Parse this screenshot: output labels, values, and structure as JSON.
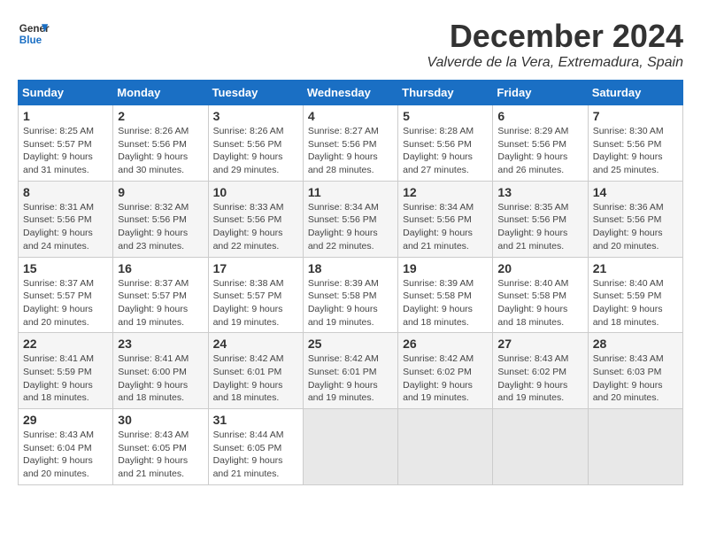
{
  "header": {
    "logo_line1": "General",
    "logo_line2": "Blue",
    "month": "December 2024",
    "location": "Valverde de la Vera, Extremadura, Spain"
  },
  "days_of_week": [
    "Sunday",
    "Monday",
    "Tuesday",
    "Wednesday",
    "Thursday",
    "Friday",
    "Saturday"
  ],
  "weeks": [
    [
      {
        "day": "1",
        "info": "Sunrise: 8:25 AM\nSunset: 5:57 PM\nDaylight: 9 hours\nand 31 minutes."
      },
      {
        "day": "2",
        "info": "Sunrise: 8:26 AM\nSunset: 5:56 PM\nDaylight: 9 hours\nand 30 minutes."
      },
      {
        "day": "3",
        "info": "Sunrise: 8:26 AM\nSunset: 5:56 PM\nDaylight: 9 hours\nand 29 minutes."
      },
      {
        "day": "4",
        "info": "Sunrise: 8:27 AM\nSunset: 5:56 PM\nDaylight: 9 hours\nand 28 minutes."
      },
      {
        "day": "5",
        "info": "Sunrise: 8:28 AM\nSunset: 5:56 PM\nDaylight: 9 hours\nand 27 minutes."
      },
      {
        "day": "6",
        "info": "Sunrise: 8:29 AM\nSunset: 5:56 PM\nDaylight: 9 hours\nand 26 minutes."
      },
      {
        "day": "7",
        "info": "Sunrise: 8:30 AM\nSunset: 5:56 PM\nDaylight: 9 hours\nand 25 minutes."
      }
    ],
    [
      {
        "day": "8",
        "info": "Sunrise: 8:31 AM\nSunset: 5:56 PM\nDaylight: 9 hours\nand 24 minutes."
      },
      {
        "day": "9",
        "info": "Sunrise: 8:32 AM\nSunset: 5:56 PM\nDaylight: 9 hours\nand 23 minutes."
      },
      {
        "day": "10",
        "info": "Sunrise: 8:33 AM\nSunset: 5:56 PM\nDaylight: 9 hours\nand 22 minutes."
      },
      {
        "day": "11",
        "info": "Sunrise: 8:34 AM\nSunset: 5:56 PM\nDaylight: 9 hours\nand 22 minutes."
      },
      {
        "day": "12",
        "info": "Sunrise: 8:34 AM\nSunset: 5:56 PM\nDaylight: 9 hours\nand 21 minutes."
      },
      {
        "day": "13",
        "info": "Sunrise: 8:35 AM\nSunset: 5:56 PM\nDaylight: 9 hours\nand 21 minutes."
      },
      {
        "day": "14",
        "info": "Sunrise: 8:36 AM\nSunset: 5:56 PM\nDaylight: 9 hours\nand 20 minutes."
      }
    ],
    [
      {
        "day": "15",
        "info": "Sunrise: 8:37 AM\nSunset: 5:57 PM\nDaylight: 9 hours\nand 20 minutes."
      },
      {
        "day": "16",
        "info": "Sunrise: 8:37 AM\nSunset: 5:57 PM\nDaylight: 9 hours\nand 19 minutes."
      },
      {
        "day": "17",
        "info": "Sunrise: 8:38 AM\nSunset: 5:57 PM\nDaylight: 9 hours\nand 19 minutes."
      },
      {
        "day": "18",
        "info": "Sunrise: 8:39 AM\nSunset: 5:58 PM\nDaylight: 9 hours\nand 19 minutes."
      },
      {
        "day": "19",
        "info": "Sunrise: 8:39 AM\nSunset: 5:58 PM\nDaylight: 9 hours\nand 18 minutes."
      },
      {
        "day": "20",
        "info": "Sunrise: 8:40 AM\nSunset: 5:58 PM\nDaylight: 9 hours\nand 18 minutes."
      },
      {
        "day": "21",
        "info": "Sunrise: 8:40 AM\nSunset: 5:59 PM\nDaylight: 9 hours\nand 18 minutes."
      }
    ],
    [
      {
        "day": "22",
        "info": "Sunrise: 8:41 AM\nSunset: 5:59 PM\nDaylight: 9 hours\nand 18 minutes."
      },
      {
        "day": "23",
        "info": "Sunrise: 8:41 AM\nSunset: 6:00 PM\nDaylight: 9 hours\nand 18 minutes."
      },
      {
        "day": "24",
        "info": "Sunrise: 8:42 AM\nSunset: 6:01 PM\nDaylight: 9 hours\nand 18 minutes."
      },
      {
        "day": "25",
        "info": "Sunrise: 8:42 AM\nSunset: 6:01 PM\nDaylight: 9 hours\nand 19 minutes."
      },
      {
        "day": "26",
        "info": "Sunrise: 8:42 AM\nSunset: 6:02 PM\nDaylight: 9 hours\nand 19 minutes."
      },
      {
        "day": "27",
        "info": "Sunrise: 8:43 AM\nSunset: 6:02 PM\nDaylight: 9 hours\nand 19 minutes."
      },
      {
        "day": "28",
        "info": "Sunrise: 8:43 AM\nSunset: 6:03 PM\nDaylight: 9 hours\nand 20 minutes."
      }
    ],
    [
      {
        "day": "29",
        "info": "Sunrise: 8:43 AM\nSunset: 6:04 PM\nDaylight: 9 hours\nand 20 minutes."
      },
      {
        "day": "30",
        "info": "Sunrise: 8:43 AM\nSunset: 6:05 PM\nDaylight: 9 hours\nand 21 minutes."
      },
      {
        "day": "31",
        "info": "Sunrise: 8:44 AM\nSunset: 6:05 PM\nDaylight: 9 hours\nand 21 minutes."
      },
      {
        "day": "",
        "info": ""
      },
      {
        "day": "",
        "info": ""
      },
      {
        "day": "",
        "info": ""
      },
      {
        "day": "",
        "info": ""
      }
    ]
  ]
}
